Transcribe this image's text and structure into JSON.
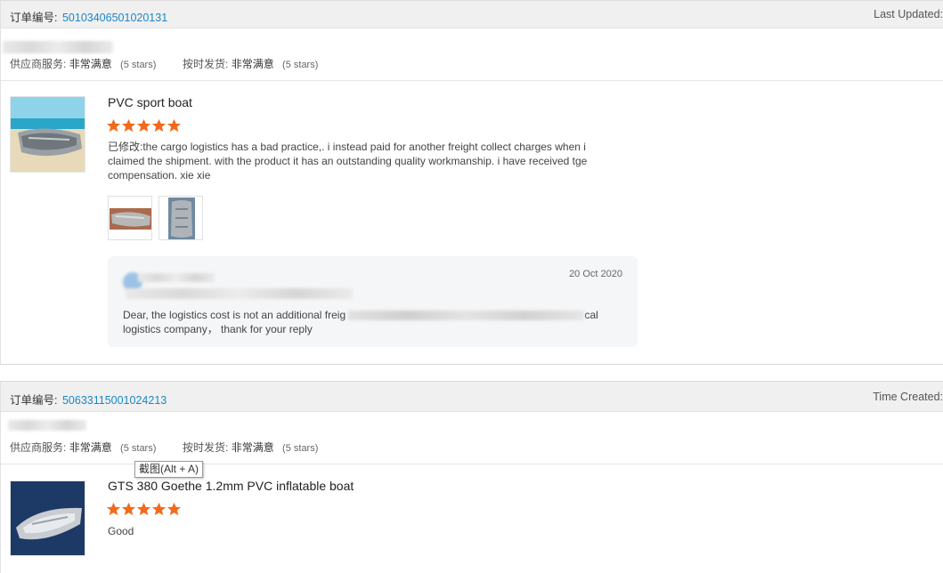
{
  "orders": [
    {
      "order_no_label": "订单编号:",
      "order_no": "50103406501020131",
      "right_label": "Last Updated:",
      "seller_service_label": "供应商服务:",
      "seller_service_value": "非常满意",
      "seller_service_stars": "(5 stars)",
      "shipping_label": "按时发货:",
      "shipping_value": "非常满意",
      "shipping_stars": "(5 stars)",
      "product_title": "PVC sport boat",
      "rating": 5,
      "review": "已修改:the cargo logistics has a bad practice,. i instead paid for another freight collect charges when i claimed the shipment. with the product it has an outstanding quality workmanship.  i have received tge compensation.  xie xie",
      "photos": 2,
      "reply": {
        "date": "20 Oct 2020",
        "text_start": "Dear, the logistics cost is not an additional freig",
        "text_end": "cal",
        "text_line2": "logistics company， thank for your reply"
      }
    },
    {
      "order_no_label": "订单编号:",
      "order_no": "50633115001024213",
      "right_label": "Time Created:",
      "seller_service_label": "供应商服务:",
      "seller_service_value": "非常满意",
      "seller_service_stars": "(5 stars)",
      "shipping_label": "按时发货:",
      "shipping_value": "非常满意",
      "shipping_stars": "(5 stars)",
      "product_title": "GTS 380 Goethe 1.2mm PVC inflatable boat",
      "rating": 5,
      "review": "Good"
    }
  ],
  "tooltip": "截图(Alt + A)",
  "colors": {
    "link": "#1a87c9",
    "star": "#f26a1b",
    "header_bg": "#f0f0f0",
    "reply_bg": "#f5f6f7"
  },
  "icons": [
    "star-icon",
    "product-thumbnail",
    "review-photo"
  ]
}
